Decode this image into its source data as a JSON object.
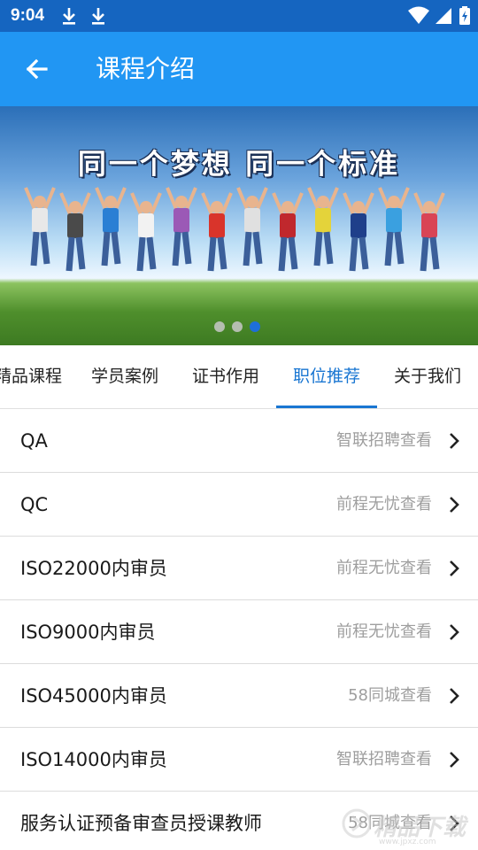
{
  "status_bar": {
    "time": "9:04",
    "icons": [
      "download-icon",
      "download-icon",
      "wifi-icon",
      "cell-signal-icon",
      "battery-icon"
    ]
  },
  "app_bar": {
    "title": "课程介绍",
    "back_icon": "arrow-left-icon",
    "color": "#2196f3"
  },
  "banner": {
    "headline": "同一个梦想  同一个标准",
    "page_count": 3,
    "active_page": 3
  },
  "tabs": {
    "items": [
      {
        "label": "精品课程",
        "active": false
      },
      {
        "label": "学员案例",
        "active": false
      },
      {
        "label": "证书作用",
        "active": false
      },
      {
        "label": "职位推荐",
        "active": true
      },
      {
        "label": "关于我们",
        "active": false
      }
    ],
    "accent": "#1976d2"
  },
  "jobs": [
    {
      "title": "QA",
      "source": "智联招聘查看"
    },
    {
      "title": "QC",
      "source": "前程无忧查看"
    },
    {
      "title": "ISO22000内审员",
      "source": "前程无忧查看"
    },
    {
      "title": "ISO9000内审员",
      "source": "前程无忧查看"
    },
    {
      "title": "ISO45000内审员",
      "source": "58同城查看"
    },
    {
      "title": "ISO14000内审员",
      "source": "智联招聘查看"
    },
    {
      "title": "服务认证预备审查员授课教师",
      "source": "58同城查看"
    }
  ],
  "watermark": {
    "text": "精品下载",
    "url": "www.jpxz.com"
  }
}
